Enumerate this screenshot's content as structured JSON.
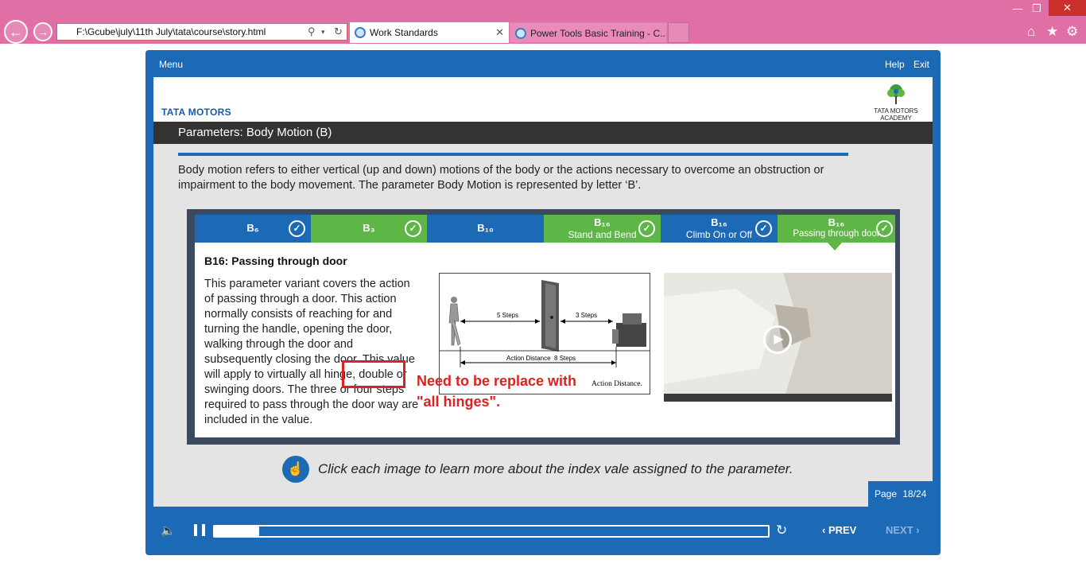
{
  "browser": {
    "address": "F:\\Gcube\\july\\11th July\\tata\\course\\story.html",
    "tabs": [
      {
        "label": "Work Standards",
        "active": true
      },
      {
        "label": "Power Tools Basic Training - C..."
      }
    ],
    "icons": [
      "back-icon",
      "forward-icon",
      "search-icon",
      "dropdown-icon",
      "refresh-icon",
      "close-icon",
      "home-icon",
      "favorites-icon",
      "settings-icon",
      "minimize-icon",
      "restore-icon"
    ]
  },
  "player": {
    "menu_label": "Menu",
    "help_label": "Help",
    "exit_label": "Exit",
    "brand": "TATA MOTORS",
    "academy": "TATA MOTORS ACADEMY",
    "slide_title": "Parameters: Body Motion (B)",
    "intro": "Body motion refers to either vertical (up and down) motions of the body or the actions necessary to overcome an obstruction or impairment to the body movement. The parameter Body Motion is represented by letter ‘B’.",
    "param_tabs": [
      {
        "title": "B₆",
        "sub": "",
        "color": "#1c69b6",
        "checked": true
      },
      {
        "title": "B₃",
        "sub": "",
        "color": "#5db646",
        "checked": true
      },
      {
        "title": "B₁₀",
        "sub": "",
        "color": "#1c69b6",
        "checked": false
      },
      {
        "title": "B₁₆",
        "sub": "Stand and Bend",
        "color": "#5db646",
        "checked": true
      },
      {
        "title": "B₁₆",
        "sub": "Climb On or Off",
        "color": "#1c69b6",
        "checked": true
      },
      {
        "title": "B₁₆",
        "sub": "Passing through door",
        "color": "#5db646",
        "checked": true,
        "selected": true
      }
    ],
    "section_title": "B16: Passing through door",
    "body_text": "This parameter variant covers the action of passing through a door. This action normally consists of reaching for and turning the handle, opening the door, walking through the door and subsequently closing the door. This value will apply to virtually all hinge, double or swinging doors. The three or four steps required to pass through the door way are included in the value.",
    "diagram": {
      "steps_left": "5 Steps",
      "steps_right": "3 Steps",
      "action_distance": "Action Distance  8 Steps",
      "caption": "Action Distance."
    },
    "annotation": "Need to be replace with \"all hinges\".",
    "hint": "Click each image to learn more about the index vale assigned to the parameter.",
    "page_label": "Page",
    "page_value": "18/24",
    "progress": 0.08,
    "prev_label": "PREV",
    "next_label": "NEXT"
  },
  "colors": {
    "brand_blue": "#1c69b6",
    "green": "#5db646",
    "annotation_red": "#e02020",
    "chrome_pink": "#df6fa5"
  }
}
